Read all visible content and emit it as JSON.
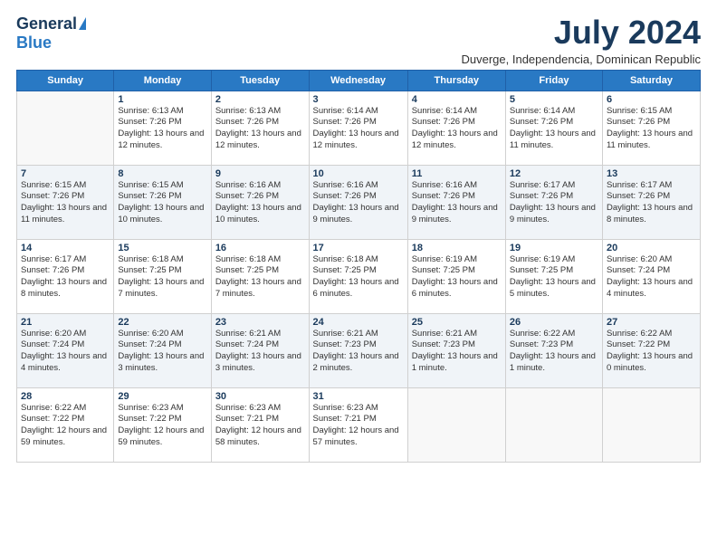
{
  "logo": {
    "general": "General",
    "blue": "Blue"
  },
  "header": {
    "title": "July 2024",
    "subtitle": "Duverge, Independencia, Dominican Republic"
  },
  "weekdays": [
    "Sunday",
    "Monday",
    "Tuesday",
    "Wednesday",
    "Thursday",
    "Friday",
    "Saturday"
  ],
  "weeks": [
    [
      {
        "day": "",
        "sunrise": "",
        "sunset": "",
        "daylight": ""
      },
      {
        "day": "1",
        "sunrise": "Sunrise: 6:13 AM",
        "sunset": "Sunset: 7:26 PM",
        "daylight": "Daylight: 13 hours and 12 minutes."
      },
      {
        "day": "2",
        "sunrise": "Sunrise: 6:13 AM",
        "sunset": "Sunset: 7:26 PM",
        "daylight": "Daylight: 13 hours and 12 minutes."
      },
      {
        "day": "3",
        "sunrise": "Sunrise: 6:14 AM",
        "sunset": "Sunset: 7:26 PM",
        "daylight": "Daylight: 13 hours and 12 minutes."
      },
      {
        "day": "4",
        "sunrise": "Sunrise: 6:14 AM",
        "sunset": "Sunset: 7:26 PM",
        "daylight": "Daylight: 13 hours and 12 minutes."
      },
      {
        "day": "5",
        "sunrise": "Sunrise: 6:14 AM",
        "sunset": "Sunset: 7:26 PM",
        "daylight": "Daylight: 13 hours and 11 minutes."
      },
      {
        "day": "6",
        "sunrise": "Sunrise: 6:15 AM",
        "sunset": "Sunset: 7:26 PM",
        "daylight": "Daylight: 13 hours and 11 minutes."
      }
    ],
    [
      {
        "day": "7",
        "sunrise": "Sunrise: 6:15 AM",
        "sunset": "Sunset: 7:26 PM",
        "daylight": "Daylight: 13 hours and 11 minutes."
      },
      {
        "day": "8",
        "sunrise": "Sunrise: 6:15 AM",
        "sunset": "Sunset: 7:26 PM",
        "daylight": "Daylight: 13 hours and 10 minutes."
      },
      {
        "day": "9",
        "sunrise": "Sunrise: 6:16 AM",
        "sunset": "Sunset: 7:26 PM",
        "daylight": "Daylight: 13 hours and 10 minutes."
      },
      {
        "day": "10",
        "sunrise": "Sunrise: 6:16 AM",
        "sunset": "Sunset: 7:26 PM",
        "daylight": "Daylight: 13 hours and 9 minutes."
      },
      {
        "day": "11",
        "sunrise": "Sunrise: 6:16 AM",
        "sunset": "Sunset: 7:26 PM",
        "daylight": "Daylight: 13 hours and 9 minutes."
      },
      {
        "day": "12",
        "sunrise": "Sunrise: 6:17 AM",
        "sunset": "Sunset: 7:26 PM",
        "daylight": "Daylight: 13 hours and 9 minutes."
      },
      {
        "day": "13",
        "sunrise": "Sunrise: 6:17 AM",
        "sunset": "Sunset: 7:26 PM",
        "daylight": "Daylight: 13 hours and 8 minutes."
      }
    ],
    [
      {
        "day": "14",
        "sunrise": "Sunrise: 6:17 AM",
        "sunset": "Sunset: 7:26 PM",
        "daylight": "Daylight: 13 hours and 8 minutes."
      },
      {
        "day": "15",
        "sunrise": "Sunrise: 6:18 AM",
        "sunset": "Sunset: 7:25 PM",
        "daylight": "Daylight: 13 hours and 7 minutes."
      },
      {
        "day": "16",
        "sunrise": "Sunrise: 6:18 AM",
        "sunset": "Sunset: 7:25 PM",
        "daylight": "Daylight: 13 hours and 7 minutes."
      },
      {
        "day": "17",
        "sunrise": "Sunrise: 6:18 AM",
        "sunset": "Sunset: 7:25 PM",
        "daylight": "Daylight: 13 hours and 6 minutes."
      },
      {
        "day": "18",
        "sunrise": "Sunrise: 6:19 AM",
        "sunset": "Sunset: 7:25 PM",
        "daylight": "Daylight: 13 hours and 6 minutes."
      },
      {
        "day": "19",
        "sunrise": "Sunrise: 6:19 AM",
        "sunset": "Sunset: 7:25 PM",
        "daylight": "Daylight: 13 hours and 5 minutes."
      },
      {
        "day": "20",
        "sunrise": "Sunrise: 6:20 AM",
        "sunset": "Sunset: 7:24 PM",
        "daylight": "Daylight: 13 hours and 4 minutes."
      }
    ],
    [
      {
        "day": "21",
        "sunrise": "Sunrise: 6:20 AM",
        "sunset": "Sunset: 7:24 PM",
        "daylight": "Daylight: 13 hours and 4 minutes."
      },
      {
        "day": "22",
        "sunrise": "Sunrise: 6:20 AM",
        "sunset": "Sunset: 7:24 PM",
        "daylight": "Daylight: 13 hours and 3 minutes."
      },
      {
        "day": "23",
        "sunrise": "Sunrise: 6:21 AM",
        "sunset": "Sunset: 7:24 PM",
        "daylight": "Daylight: 13 hours and 3 minutes."
      },
      {
        "day": "24",
        "sunrise": "Sunrise: 6:21 AM",
        "sunset": "Sunset: 7:23 PM",
        "daylight": "Daylight: 13 hours and 2 minutes."
      },
      {
        "day": "25",
        "sunrise": "Sunrise: 6:21 AM",
        "sunset": "Sunset: 7:23 PM",
        "daylight": "Daylight: 13 hours and 1 minute."
      },
      {
        "day": "26",
        "sunrise": "Sunrise: 6:22 AM",
        "sunset": "Sunset: 7:23 PM",
        "daylight": "Daylight: 13 hours and 1 minute."
      },
      {
        "day": "27",
        "sunrise": "Sunrise: 6:22 AM",
        "sunset": "Sunset: 7:22 PM",
        "daylight": "Daylight: 13 hours and 0 minutes."
      }
    ],
    [
      {
        "day": "28",
        "sunrise": "Sunrise: 6:22 AM",
        "sunset": "Sunset: 7:22 PM",
        "daylight": "Daylight: 12 hours and 59 minutes."
      },
      {
        "day": "29",
        "sunrise": "Sunrise: 6:23 AM",
        "sunset": "Sunset: 7:22 PM",
        "daylight": "Daylight: 12 hours and 59 minutes."
      },
      {
        "day": "30",
        "sunrise": "Sunrise: 6:23 AM",
        "sunset": "Sunset: 7:21 PM",
        "daylight": "Daylight: 12 hours and 58 minutes."
      },
      {
        "day": "31",
        "sunrise": "Sunrise: 6:23 AM",
        "sunset": "Sunset: 7:21 PM",
        "daylight": "Daylight: 12 hours and 57 minutes."
      },
      {
        "day": "",
        "sunrise": "",
        "sunset": "",
        "daylight": ""
      },
      {
        "day": "",
        "sunrise": "",
        "sunset": "",
        "daylight": ""
      },
      {
        "day": "",
        "sunrise": "",
        "sunset": "",
        "daylight": ""
      }
    ]
  ]
}
